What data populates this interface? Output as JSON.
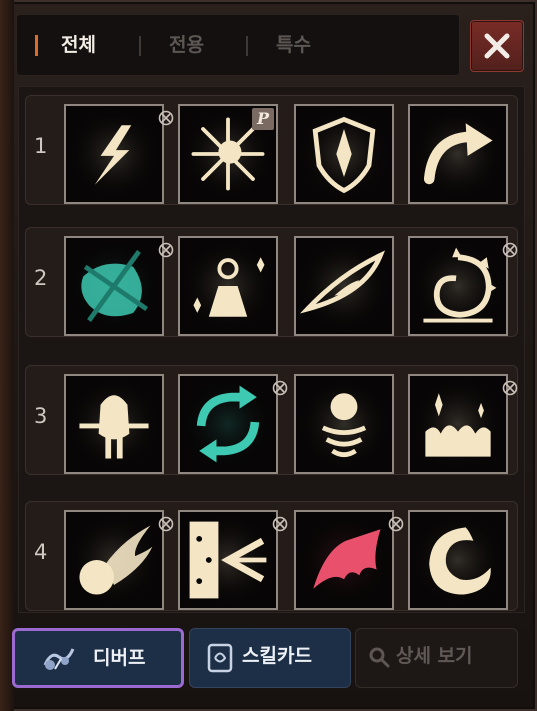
{
  "tabs": [
    {
      "label": "전체",
      "active": true
    },
    {
      "label": "전용",
      "active": false
    },
    {
      "label": "특수",
      "active": false
    }
  ],
  "close_icon": "close-icon",
  "rows": [
    {
      "number": "1",
      "slots": [
        {
          "icon": "lightning-bolt-icon",
          "locked": true
        },
        {
          "icon": "burst-star-icon",
          "badge": "P"
        },
        {
          "icon": "shield-icon"
        },
        {
          "icon": "curved-arrow-icon"
        }
      ]
    },
    {
      "number": "2",
      "slots": [
        {
          "icon": "crossed-leaf-icon",
          "locked": true,
          "tint": "#3dc9b2"
        },
        {
          "icon": "anvil-sparkle-icon"
        },
        {
          "icon": "dragon-eye-icon"
        },
        {
          "icon": "spiked-swirl-icon",
          "locked": true
        }
      ]
    },
    {
      "number": "3",
      "slots": [
        {
          "icon": "helmet-knight-icon"
        },
        {
          "icon": "cycle-arrows-icon",
          "locked": true,
          "tint": "#3dc9b2"
        },
        {
          "icon": "orb-coil-icon"
        },
        {
          "icon": "sparkle-fire-icon",
          "locked": true
        }
      ]
    },
    {
      "number": "4",
      "slots": [
        {
          "icon": "fireball-icon",
          "locked": true
        },
        {
          "icon": "door-arrow-icon",
          "locked": true
        },
        {
          "icon": "bat-wing-icon",
          "locked": true,
          "tint": "#e9506c"
        },
        {
          "icon": "crescent-swirl-icon"
        }
      ]
    }
  ],
  "bottom": {
    "debuff_label": "디버프",
    "skillcard_label": "스킬카드",
    "detail_label": "상세 보기"
  },
  "colors": {
    "accent": "#d96d2d",
    "icon_glow": "#f4e6c4",
    "teal": "#3dc9b2",
    "pink": "#e9506c",
    "selected_border": "#9a6ad0",
    "button_blue": "#1d2f47"
  }
}
